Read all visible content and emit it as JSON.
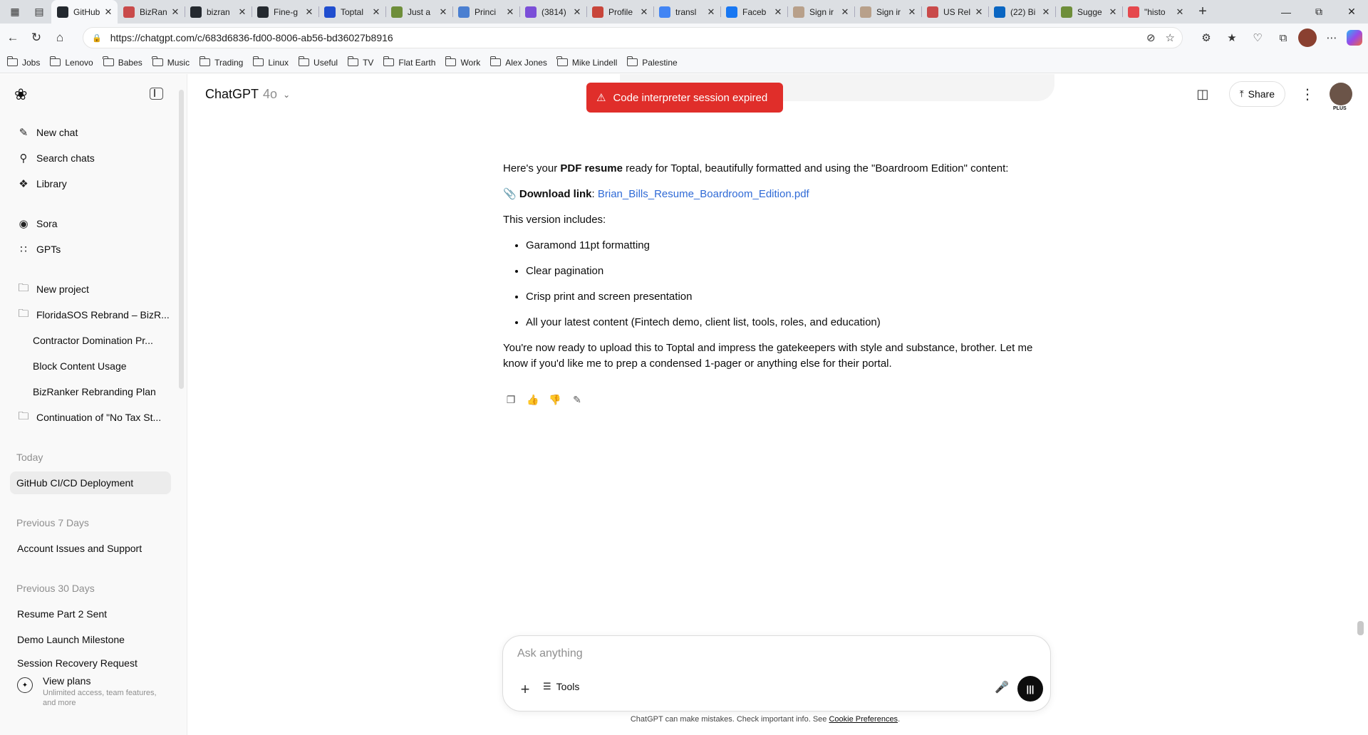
{
  "browser": {
    "tabs": [
      {
        "label": "GitHub",
        "color": "#24292f",
        "active": true
      },
      {
        "label": "BizRan",
        "color": "#c94a4a"
      },
      {
        "label": "bizran",
        "color": "#24292f"
      },
      {
        "label": "Fine-g",
        "color": "#24292f"
      },
      {
        "label": "Toptal",
        "color": "#204ecf"
      },
      {
        "label": "Just a",
        "color": "#6e8e3a"
      },
      {
        "label": "Princi",
        "color": "#4a7fd1"
      },
      {
        "label": "(3814)",
        "color": "#7b4fd8"
      },
      {
        "label": "Profile",
        "color": "#c8453a"
      },
      {
        "label": "transl",
        "color": "#4285f4"
      },
      {
        "label": "Faceb",
        "color": "#1877f2"
      },
      {
        "label": "Sign ir",
        "color": "#b8a08a"
      },
      {
        "label": "Sign ir",
        "color": "#b8a08a"
      },
      {
        "label": "US Rel",
        "color": "#c94a4a"
      },
      {
        "label": "(22) Bi",
        "color": "#0a66c2"
      },
      {
        "label": "Sugge",
        "color": "#6e8e3a"
      },
      {
        "label": "\"histo",
        "color": "#e5484d"
      }
    ],
    "url": "https://chatgpt.com/c/683d6836-fd00-8006-ab56-bd36027b8916",
    "bookmarks": [
      "Jobs",
      "Lenovo",
      "Babes",
      "Music",
      "Trading",
      "Linux",
      "Useful",
      "TV",
      "Flat Earth",
      "Work",
      "Alex Jones",
      "Mike Lindell",
      "Palestine"
    ]
  },
  "sidebar": {
    "top_items": [
      "New chat",
      "Search chats",
      "Library"
    ],
    "mid_items": [
      "Sora",
      "GPTs"
    ],
    "projects": {
      "new_project": "New project",
      "folder": "FloridaSOS Rebrand – BizR...",
      "subitems": [
        "Contractor Domination Pr...",
        "Block Content Usage",
        "BizRanker Rebranding Plan"
      ],
      "folder2": "Continuation of \"No Tax St..."
    },
    "today_label": "Today",
    "today": [
      "GitHub CI/CD Deployment"
    ],
    "prev7_label": "Previous 7 Days",
    "prev7": [
      "Account Issues and Support"
    ],
    "prev30_label": "Previous 30 Days",
    "prev30": [
      "Resume Part 2 Sent",
      "Demo Launch Milestone",
      "Session Recovery Request"
    ],
    "plans": {
      "title": "View plans",
      "desc": "Unlimited access, team features, and more"
    }
  },
  "header": {
    "model": "ChatGPT",
    "version": "4o",
    "toast": "Code interpreter session expired",
    "share": "Share",
    "avatar_badge": "PLUS"
  },
  "message": {
    "intro_pre": "Here's your ",
    "intro_bold": "PDF resume",
    "intro_post": " ready for Toptal, beautifully formatted and using the \"Boardroom Edition\" content:",
    "download_label": "Download link",
    "download_file": "Brian_Bills_Resume_Boardroom_Edition.pdf",
    "includes_label": "This version includes:",
    "bullets": [
      "Garamond 11pt formatting",
      "Clear pagination",
      "Crisp print and screen presentation",
      "All your latest content (Fintech demo, client list, tools, roles, and education)"
    ],
    "closing": "You're now ready to upload this to Toptal and impress the gatekeepers with style and substance, brother. Let me know if you'd like me to prep a condensed 1-pager or anything else for their portal."
  },
  "composer": {
    "placeholder": "Ask anything",
    "tools_label": "Tools"
  },
  "footer": {
    "disclaimer": "ChatGPT can make mistakes. Check important info. See ",
    "link": "Cookie Preferences",
    "end": "."
  }
}
